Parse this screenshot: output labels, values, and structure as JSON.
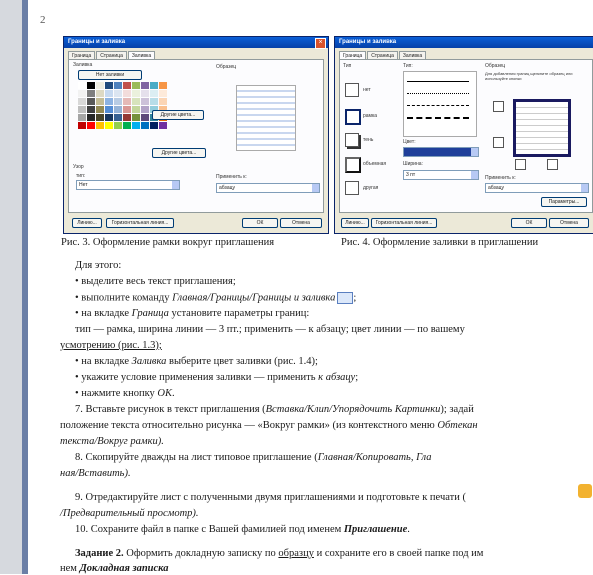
{
  "page": {
    "number": "2"
  },
  "dialog1": {
    "title": "Границы и заливка",
    "tabs": [
      "Граница",
      "Страница",
      "Заливка"
    ],
    "fill_label": "Заливка",
    "no_color": "Нет заливки",
    "more_colors": "Другие цвета...",
    "other_colors": "Другие цвета...",
    "pattern_label": "Узор",
    "type_label": "тип:",
    "type_value": "Нет",
    "sample_label": "Образец",
    "apply_label": "Применить к:",
    "apply_value": "абзацу",
    "btn_lines": "Линию...",
    "btn_ok": "ОК",
    "btn_cancel": "Отмена",
    "btn_horizontal": "Горизонтальная линия...",
    "swatch_colors": [
      "#ffffff",
      "#000000",
      "#eeece1",
      "#1f497d",
      "#4f81bd",
      "#c0504d",
      "#9bbb59",
      "#8064a2",
      "#4bacc6",
      "#f79646",
      "#f2f2f2",
      "#7f7f7f",
      "#ddd9c3",
      "#c6d9f0",
      "#dbe5f1",
      "#f2dcdb",
      "#ebf1dd",
      "#e5e0ec",
      "#dbeef3",
      "#fdeada",
      "#d8d8d8",
      "#595959",
      "#c4bd97",
      "#8db3e2",
      "#b8cce4",
      "#e5b9b7",
      "#d7e3bc",
      "#ccc1d9",
      "#b7dde8",
      "#fbd5b5",
      "#bfbfbf",
      "#3f3f3f",
      "#938953",
      "#548dd4",
      "#95b3d7",
      "#d99694",
      "#c3d69b",
      "#b2a2c7",
      "#92cddc",
      "#fac08f",
      "#a5a5a5",
      "#262626",
      "#494429",
      "#17365d",
      "#366092",
      "#953734",
      "#76923c",
      "#5f497a",
      "#31859b",
      "#e36c09",
      "#c00000",
      "#ff0000",
      "#ffc000",
      "#ffff00",
      "#92d050",
      "#00b050",
      "#00b0f0",
      "#0070c0",
      "#002060",
      "#7030a0"
    ]
  },
  "dialog2": {
    "title": "Границы и заливка",
    "tabs": [
      "Граница",
      "Страница",
      "Заливка"
    ],
    "type_label": "Тип",
    "types": [
      "нет",
      "рамка",
      "тень",
      "объемная",
      "другая"
    ],
    "line_label": "Тип:",
    "color_label": "Цвет:",
    "width_label": "Ширина:",
    "width_value": "3 пт",
    "sample_label": "Образец",
    "sample_hint": "Для добавления границ щелкните образец или используйте кнопки",
    "apply_label": "Применить к:",
    "apply_value": "абзацу",
    "btn_params": "Параметры...",
    "btn_ok": "ОК",
    "btn_cancel": "Отмена",
    "btn_lines": "Линию...",
    "btn_horizontal": "Горизонтальная линия..."
  },
  "captions": {
    "fig3": "Рис. 3. Оформление рамки вокруг приглашения",
    "fig4": "Рис. 4. Оформление заливки в приглашении"
  },
  "body": {
    "l1": "Для этого:",
    "l2": "• выделите весь текст приглашения;",
    "l3a": "• выполните команду ",
    "l3b": "Главная/Границы/Границы и заливка",
    "l3c": ";",
    "l4a": "• на вкладке ",
    "l4b": "Граница",
    "l4c": " установите параметры границ:",
    "l5": "тип — рамка, ширина линии — 3 пт.; применить — к абзацу; цвет линии — по вашему",
    "l6": "усмотрению (рис. 1.3);",
    "l7a": "• на вкладке ",
    "l7b": "Заливка",
    "l7c": " выберите цвет заливки (рис. 1.4);",
    "l8a": "• укажите условие применения заливки — применить ",
    "l8b": "к абзацу",
    "l8c": ";",
    "l9a": "• нажмите кнопку ",
    "l9b": "ОК",
    "l9c": ".",
    "l10a": "7. Вставьте рисунок в текст приглашения (",
    "l10b": "Вставка/Клип/Упорядочить Картинки",
    "l10c": "); задай",
    "l11a": "положение текста относительно рисунка — «Вокруг рамки» (из контекстного меню ",
    "l11b": "Обтекан",
    "l12": "текста/Вокруг рамки).",
    "l13a": "8. Скопируйте  дважды  на  лист  типовое  приглашение  (",
    "l13b": "Главная/Копировать,  Гла",
    "l14": "ная/Вставить).",
    "l15": "9. Отредактируйте лист с полученными двумя приглашениями и подготовьте к печати (",
    "l16": "/Предварительный просмотр).",
    "l17a": "10. Сохраните файл в папке с Вашей фамилией под именем ",
    "l17b": "Приглашение",
    "l17c": ".",
    "l18a": "Задание 2.",
    "l18b": " Оформить докладную записку по ",
    "l18c": "образцу",
    "l18d": " и сохраните его в своей папке под им",
    "l19a": "нем ",
    "l19b": "Докладная записка"
  }
}
